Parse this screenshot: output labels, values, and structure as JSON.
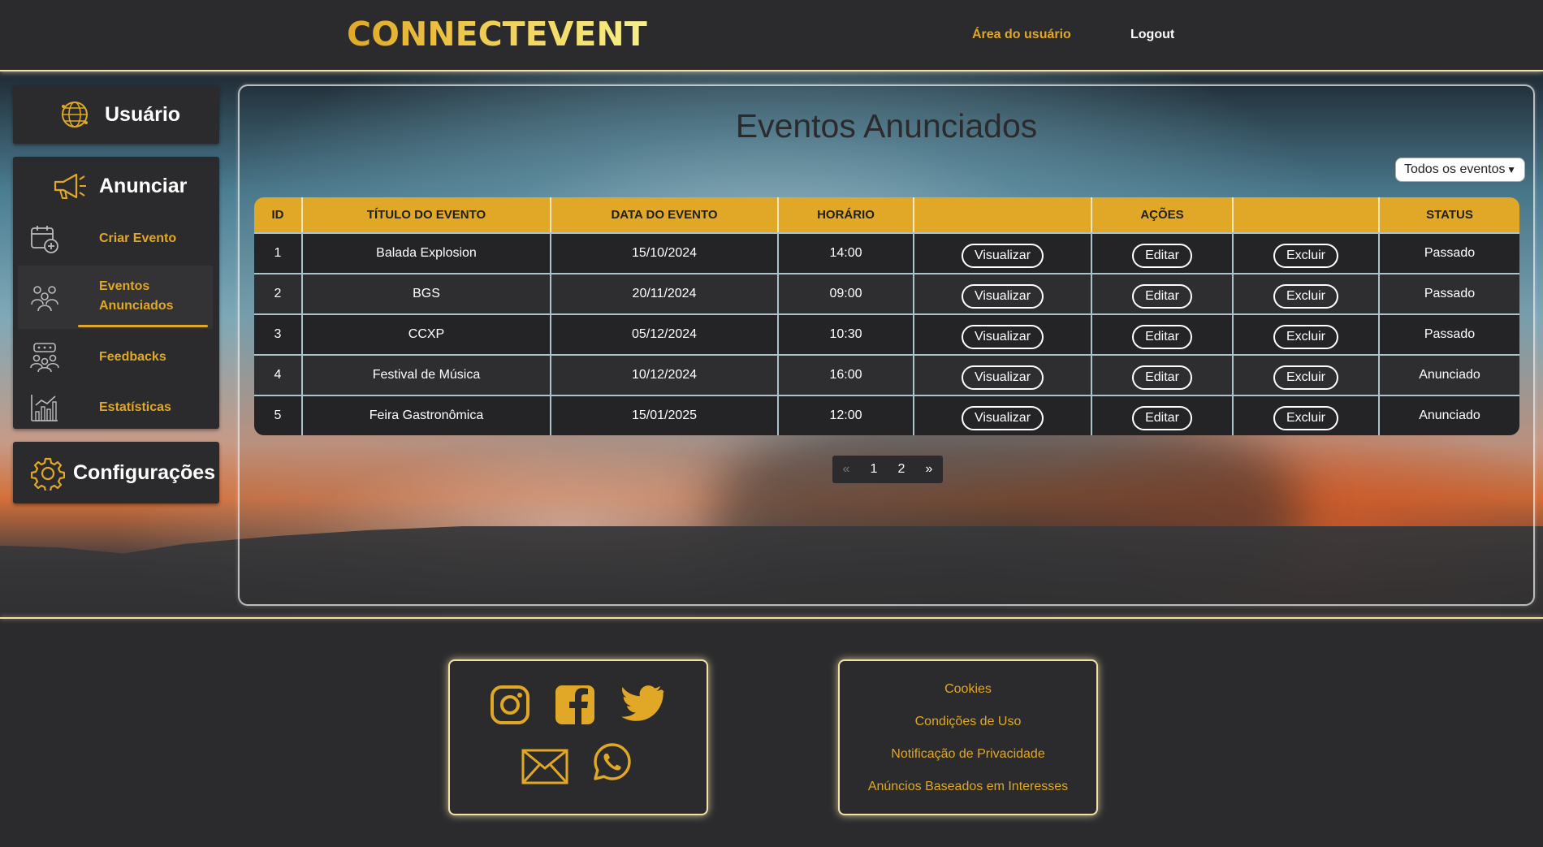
{
  "header": {
    "logo": "CONNECTEVENT",
    "nav_user_area": "Área do usuário",
    "nav_logout": "Logout"
  },
  "sidebar": {
    "user": {
      "label": "Usuário",
      "icon": "globe-icon"
    },
    "anunciar": {
      "label": "Anunciar",
      "icon": "megaphone-icon",
      "items": [
        {
          "label": "Criar Evento",
          "icon": "calendar-add-icon"
        },
        {
          "label": "Eventos Anunciados",
          "icon": "people-event-icon",
          "active": true
        },
        {
          "label": "Feedbacks",
          "icon": "feedback-group-icon"
        },
        {
          "label": "Estatísticas",
          "icon": "stats-chart-icon"
        }
      ]
    },
    "config": {
      "label": "Configurações",
      "icon": "gear-icon"
    }
  },
  "main": {
    "title": "Eventos Anunciados",
    "filter": {
      "selected": "Todos os eventos"
    },
    "table": {
      "headers": [
        "ID",
        "Título do Evento",
        "Data do Evento",
        "Horário",
        "",
        "Ações",
        "",
        "Status"
      ],
      "action_labels": {
        "view": "Visualizar",
        "edit": "Editar",
        "delete": "Excluir"
      },
      "rows": [
        {
          "id": "1",
          "title": "Balada Explosion",
          "date": "15/10/2024",
          "time": "14:00",
          "status": "Passado"
        },
        {
          "id": "2",
          "title": "BGS",
          "date": "20/11/2024",
          "time": "09:00",
          "status": "Passado"
        },
        {
          "id": "3",
          "title": "CCXP",
          "date": "05/12/2024",
          "time": "10:30",
          "status": "Passado"
        },
        {
          "id": "4",
          "title": "Festival de Música",
          "date": "10/12/2024",
          "time": "16:00",
          "status": "Anunciado"
        },
        {
          "id": "5",
          "title": "Feira Gastronômica",
          "date": "15/01/2025",
          "time": "12:00",
          "status": "Anunciado"
        }
      ]
    },
    "pagination": {
      "prev": "«",
      "pages": [
        "1",
        "2"
      ],
      "next": "»"
    }
  },
  "footer": {
    "social_icons": [
      "instagram-icon",
      "facebook-icon",
      "twitter-icon",
      "mail-icon",
      "whatsapp-icon"
    ],
    "links": [
      "Cookies",
      "Condições de Uso",
      "Notificação de Privacidade",
      "Anúncios Baseados em Interesses"
    ]
  },
  "colors": {
    "accent": "#e0a826",
    "background": "#2b2b2d",
    "glow": "#f3e0a8"
  }
}
